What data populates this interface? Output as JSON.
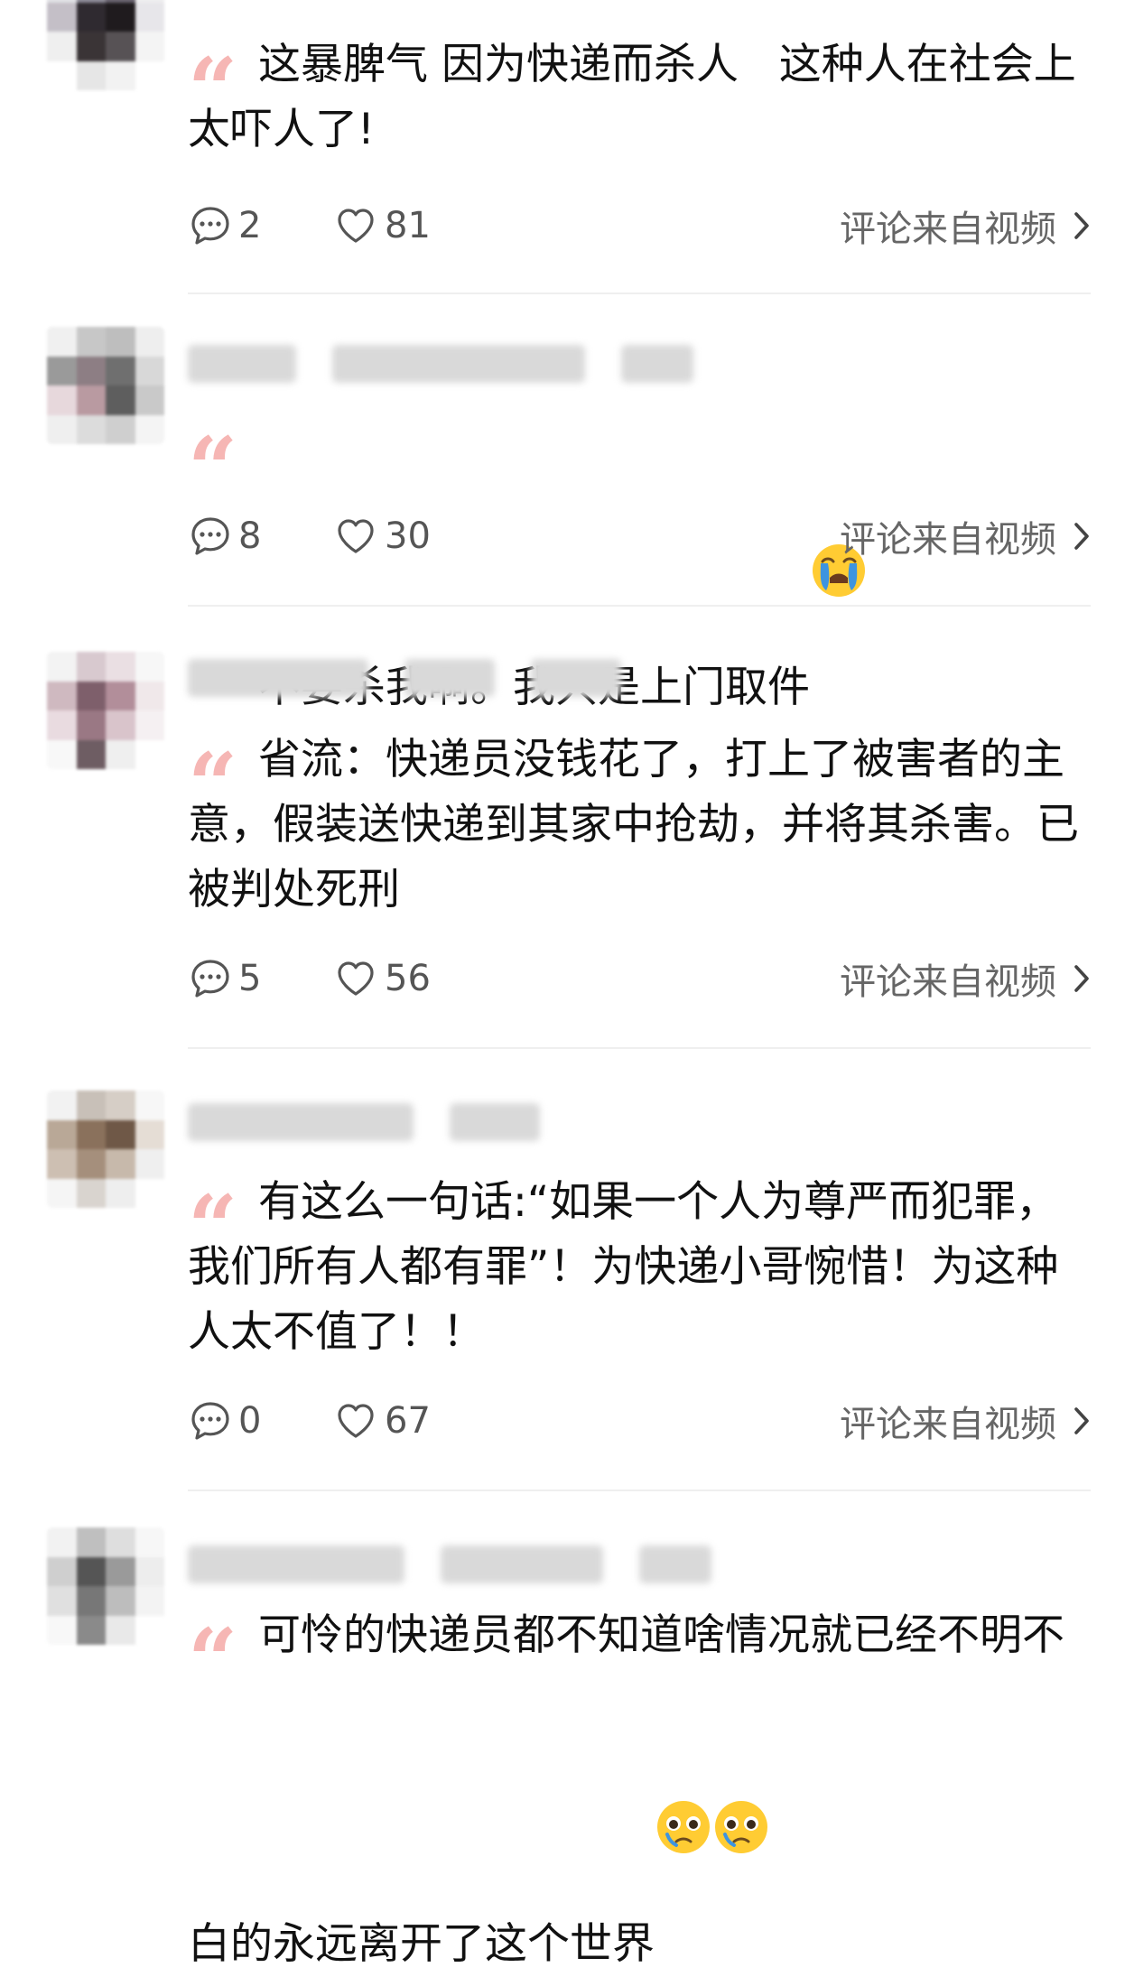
{
  "comments": [
    {
      "text": "这暴脾气 因为快递而杀人   这种人在社会上太吓人了!",
      "reply_count": "2",
      "like_count": "81",
      "source": "评论来自视频"
    },
    {
      "text": "不要杀我啊。我只是上门取件",
      "emoji": "loudly-crying-face",
      "reply_count": "8",
      "like_count": "30",
      "source": "评论来自视频"
    },
    {
      "text": "省流：快递员没钱花了，打上了被害者的主意，假装送快递到其家中抢劫，并将其杀害。已被判处死刑",
      "reply_count": "5",
      "like_count": "56",
      "source": "评论来自视频"
    },
    {
      "text": "有这么一句话:“如果一个人为尊严而犯罪，我们所有人都有罪”！为快递小哥惋惜！为这种人太不值了！！",
      "reply_count": "0",
      "like_count": "67",
      "source": "评论来自视频"
    },
    {
      "text": "可怜的快递员都不知道啥情况就已经不明不白的永远离开了这个世界",
      "emoji": "pleading-face",
      "reply_count": "",
      "like_count": "",
      "source": ""
    }
  ],
  "colors": {
    "quote_mark": "#f6b6b4",
    "text": "#111111",
    "meta": "#555555",
    "divider": "#efefef"
  },
  "icons": {
    "reply": "chat-bubble-icon",
    "like": "heart-outline-icon",
    "source": "chevron-right-icon"
  }
}
